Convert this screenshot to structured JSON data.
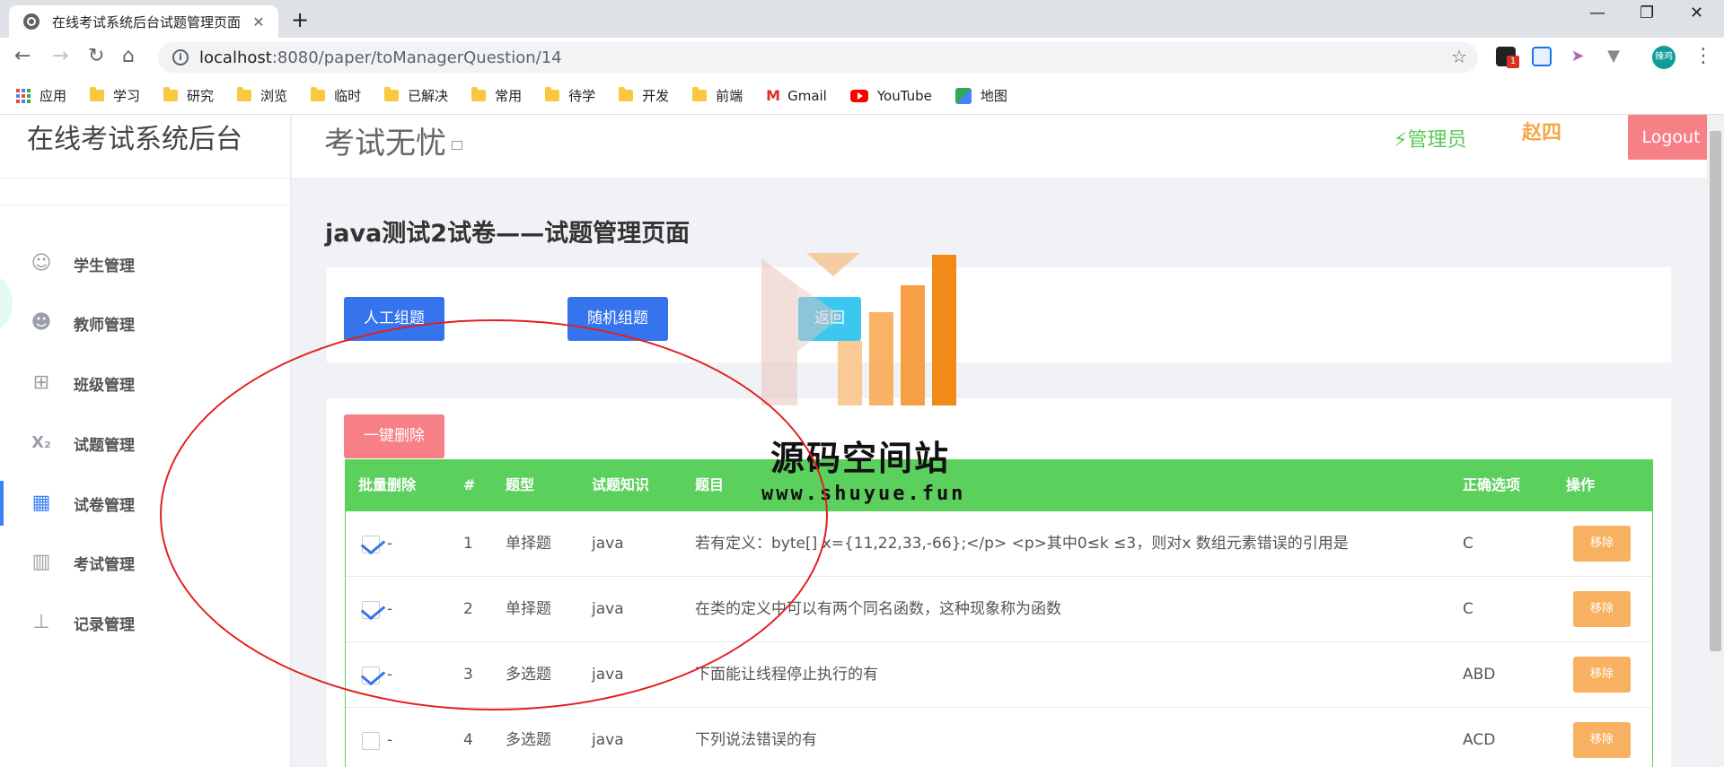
{
  "browser": {
    "tab_title": "在线考试系统后台试题管理页面",
    "url_host": "localhost",
    "url_rest": ":8080/paper/toManagerQuestion/14",
    "ext_badge": "1",
    "profile": "辣鸡",
    "bookmarks": [
      "应用",
      "学习",
      "研究",
      "浏览",
      "临时",
      "已解决",
      "常用",
      "待学",
      "开发",
      "前端",
      "Gmail",
      "YouTube",
      "地图"
    ]
  },
  "sidebar": {
    "brand": "在线考试系统后台",
    "items": [
      {
        "label": "学生管理",
        "icon": "student-icon"
      },
      {
        "label": "教师管理",
        "icon": "teacher-icon"
      },
      {
        "label": "班级管理",
        "icon": "class-icon"
      },
      {
        "label": "试题管理",
        "icon": "question-icon"
      },
      {
        "label": "试卷管理",
        "icon": "paper-icon"
      },
      {
        "label": "考试管理",
        "icon": "exam-icon"
      },
      {
        "label": "记录管理",
        "icon": "record-icon"
      }
    ],
    "active_index": 4
  },
  "header": {
    "site_title": "考试无忧",
    "role": "管理员",
    "username": "赵四",
    "logout": "Logout"
  },
  "main": {
    "heading": "java测试2试卷——试题管理页面",
    "buttons": {
      "manual": "人工组题",
      "random": "随机组题",
      "back": "返回",
      "batch_delete": "一键删除"
    },
    "table": {
      "headers": [
        "批量删除",
        "#",
        "题型",
        "试题知识",
        "题目",
        "正确选项",
        "操作"
      ],
      "rows": [
        {
          "checked": true,
          "dash": "-",
          "num": "1",
          "type": "单择题",
          "knowledge": "java",
          "question": "若有定义：byte[] x={11,22,33,-66};</p> <p>其中0≤k ≤3，则对x 数组元素错误的引用是",
          "answer": "C",
          "action": "移除"
        },
        {
          "checked": true,
          "dash": "-",
          "num": "2",
          "type": "单择题",
          "knowledge": "java",
          "question": "在类的定义中可以有两个同名函数，这种现象称为函数",
          "answer": "C",
          "action": "移除"
        },
        {
          "checked": true,
          "dash": "-",
          "num": "3",
          "type": "多选题",
          "knowledge": "java",
          "question": "下面能让线程停止执行的有",
          "answer": "ABD",
          "action": "移除"
        },
        {
          "checked": false,
          "dash": "-",
          "num": "4",
          "type": "多选题",
          "knowledge": "java",
          "question": "下列说法错误的有",
          "answer": "ACD",
          "action": "移除"
        }
      ]
    }
  },
  "watermark": {
    "text": "源码空间站",
    "url": "www.shuyue.fun"
  },
  "colors": {
    "accent_blue": "#3574ec",
    "table_green": "#5cd05c",
    "remove_orange": "#f7b160",
    "logout_red": "#f77f86"
  }
}
